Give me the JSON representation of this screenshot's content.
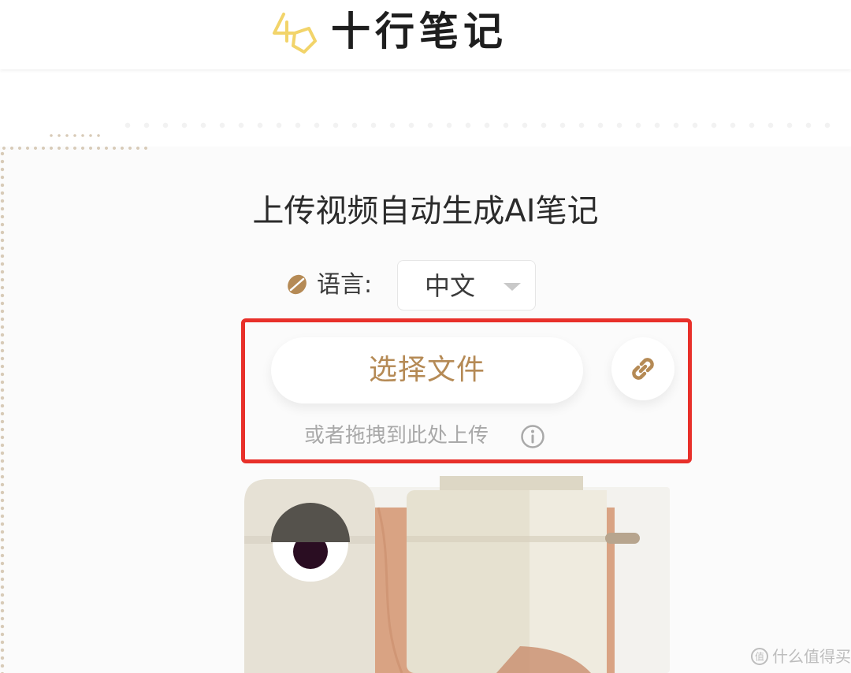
{
  "header": {
    "brand_name": "十行笔记",
    "logo_icon": "brand-logo-icon"
  },
  "main": {
    "title": "上传视频自动生成AI笔记",
    "language": {
      "label": "语言:",
      "selected_value": "中文",
      "icon": "coffee-bean-icon"
    },
    "upload": {
      "choose_file_label": "选择文件",
      "link_icon": "link-icon",
      "hint": "或者拖拽到此处上传",
      "info_icon": "info-icon"
    }
  },
  "watermark": {
    "text": "什么值得买"
  },
  "colors": {
    "accent": "#b58a55",
    "highlight_border": "#e8302a",
    "logo_yellow": "#f2d46a",
    "text_dark": "#2b2b2b",
    "hint_gray": "#a9a9a9"
  }
}
